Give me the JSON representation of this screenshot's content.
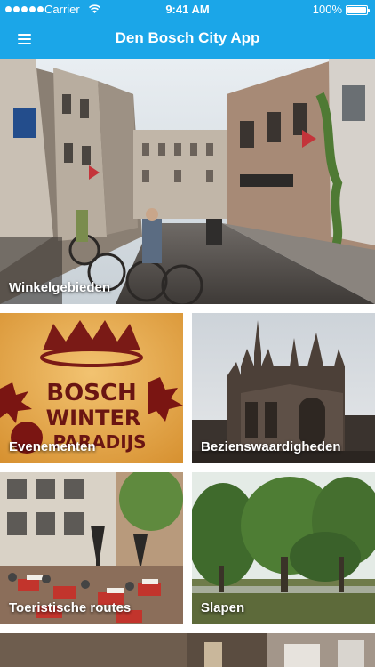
{
  "status_bar": {
    "carrier": "Carrier",
    "time": "9:41 AM",
    "battery": "100%"
  },
  "nav": {
    "title": "Den Bosch City App",
    "menu_icon": "hamburger-menu-icon"
  },
  "tiles": [
    {
      "label": "Winkelgebieden"
    },
    {
      "label": "Evenementen",
      "sign_text": [
        "BOSCH",
        "WINTER",
        "PARADIJS"
      ]
    },
    {
      "label": "Bezienswaardigheden"
    },
    {
      "label": "Toeristische routes"
    },
    {
      "label": "Slapen"
    }
  ],
  "colors": {
    "accent": "#1ba6e8",
    "label_text": "#ffffff"
  }
}
